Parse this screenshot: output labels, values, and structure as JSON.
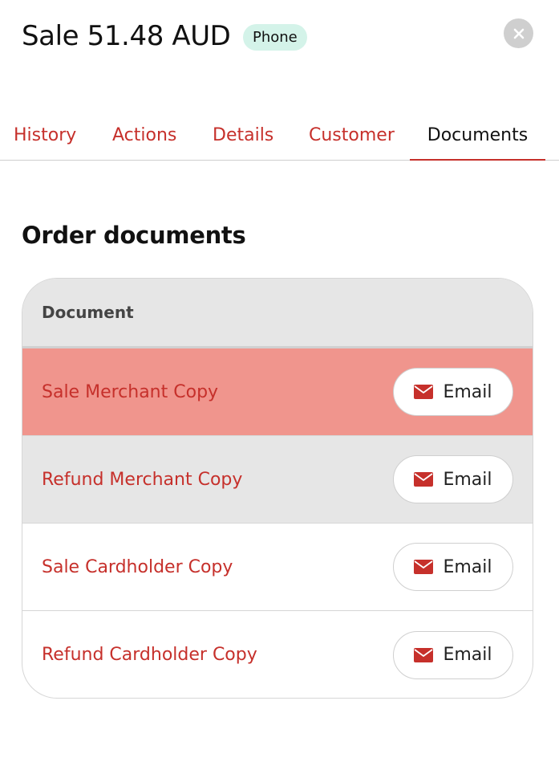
{
  "header": {
    "title": "Sale 51.48 AUD",
    "channel_badge": "Phone",
    "badge_color": "#d4f3e9"
  },
  "tabs": [
    {
      "label": "History",
      "active": false
    },
    {
      "label": "Actions",
      "active": false
    },
    {
      "label": "Details",
      "active": false
    },
    {
      "label": "Customer",
      "active": false
    },
    {
      "label": "Documents",
      "active": true
    }
  ],
  "documents": {
    "section_title": "Order documents",
    "column_header": "Document",
    "rows": [
      {
        "name": "Sale Merchant Copy",
        "action_label": "Email",
        "highlighted": true
      },
      {
        "name": "Refund Merchant Copy",
        "action_label": "Email",
        "highlighted": false
      },
      {
        "name": "Sale Cardholder Copy",
        "action_label": "Email",
        "highlighted": false
      },
      {
        "name": "Refund Cardholder Copy",
        "action_label": "Email",
        "highlighted": false
      }
    ]
  },
  "icons": {
    "close": "close-icon",
    "email": "envelope-icon"
  },
  "colors": {
    "accent": "#c6302b",
    "row_highlight": "#f0958d",
    "header_bg": "#e6e6e6"
  }
}
